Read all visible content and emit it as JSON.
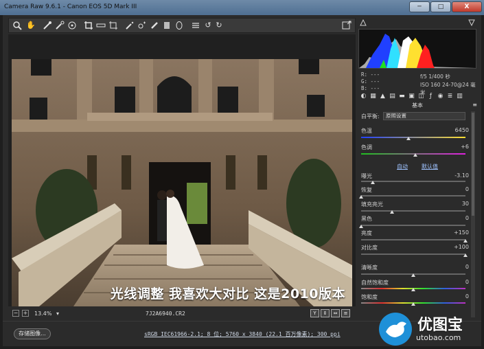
{
  "window": {
    "title": "Camera Raw 9.6.1 - Canon EOS 5D Mark III",
    "min_label": "─",
    "max_label": "□",
    "close_label": "X"
  },
  "toolbar": {
    "tools": [
      "zoom-tool",
      "hand-tool",
      "white-balance-tool",
      "color-sampler-tool",
      "target-adjustment-tool",
      "crop-tool",
      "straighten-tool",
      "transform-tool",
      "spot-removal-tool",
      "red-eye-tool",
      "adjustment-brush-tool",
      "graduated-filter-tool",
      "radial-filter-tool",
      "preferences-tool",
      "rotate-left-tool",
      "rotate-right-tool"
    ],
    "fullscreen_icon": "fullscreen-icon"
  },
  "preview": {
    "caption": "光线调整 我喜欢大对比 这是2010版本"
  },
  "statusbar": {
    "zoom": "13.4%",
    "zoom_dropdown": "▾",
    "filename": "7J2A6940.CR2",
    "view_buttons": [
      "Y",
      "⇕",
      "⇔",
      "≡"
    ]
  },
  "histogram": {
    "r": "R:  ---",
    "g": "G:  ---",
    "b": "B:  ---",
    "aperture_shutter": "f/5   1/400 秒",
    "iso_lens": "ISO 160   24-70@24 毫米",
    "colors": {
      "red": "#ff2020",
      "green": "#20e020",
      "blue": "#2040ff",
      "yellow": "#ffe030",
      "cyan": "#30e0ff",
      "white": "#ffffff"
    }
  },
  "panel": {
    "title": "基本",
    "menu": "≡",
    "white_balance_label": "白平衡:",
    "white_balance_value": "原照设置",
    "temperature_label": "色温",
    "temperature_value": "6450",
    "tint_label": "色调",
    "tint_value": "+6",
    "auto_label": "自动",
    "default_label": "默认值",
    "exposure_label": "曝光",
    "exposure_value": "-3.10",
    "recovery_label": "恢复",
    "recovery_value": "0",
    "fill_light_label": "填充亮光",
    "fill_light_value": "30",
    "blacks_label": "黑色",
    "blacks_value": "0",
    "brightness_label": "亮度",
    "brightness_value": "+150",
    "contrast_label": "对比度",
    "contrast_value": "+100",
    "clarity_label": "清晰度",
    "clarity_value": "0",
    "vibrance_label": "自然饱和度",
    "vibrance_value": "0",
    "saturation_label": "饱和度",
    "saturation_value": "0"
  },
  "bottom": {
    "save_label": "存储图像...",
    "workflow_link": "sRGB IEC61966-2.1; 8 位; 5760 x 3840 (22.1 百万像素); 300 ppi"
  },
  "watermark": {
    "brand": "优图宝",
    "url": "utobao.com",
    "accent": "#1e90d8"
  }
}
